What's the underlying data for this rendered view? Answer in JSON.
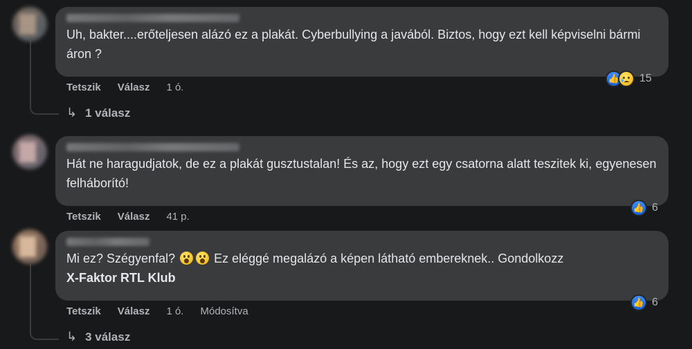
{
  "comments": [
    {
      "text": "Uh, bakter....erőteljesen alázó ez a plakát. Cyberbullying a javából. Biztos, hogy ezt kell képviselni bármi áron ?",
      "reactions": {
        "icons": [
          "like-icon",
          "sad-icon"
        ],
        "count": "15"
      },
      "actions": {
        "like": "Tetszik",
        "reply": "Válasz",
        "time": "1 ó."
      },
      "replies": "1 válasz"
    },
    {
      "text": "Hát ne haragudjatok, de ez a plakát gusztustalan! És az, hogy ezt egy csatorna alatt teszitek ki, egyenesen felháborító!",
      "reactions": {
        "icons": [
          "like-icon"
        ],
        "count": "6"
      },
      "actions": {
        "like": "Tetszik",
        "reply": "Válasz",
        "time": "41 p."
      }
    },
    {
      "text_before": "Mi ez? Szégyenfal?",
      "emoji": "astonished-face-icon",
      "text_after": "Ez eléggé megalázó a képen látható embereknek.. Gondolkozz",
      "mention": "X-Faktor RTL Klub",
      "reactions": {
        "icons": [
          "like-icon"
        ],
        "count": "6"
      },
      "actions": {
        "like": "Tetszik",
        "reply": "Válasz",
        "time": "1 ó.",
        "edited": "Módosítva"
      },
      "replies": "3 válasz"
    }
  ],
  "colors": {
    "background": "#18191a",
    "bubble": "#3a3b3c",
    "text": "#e4e6eb",
    "secondary_text": "#b0b3b8",
    "like_blue": "#1877f2"
  }
}
